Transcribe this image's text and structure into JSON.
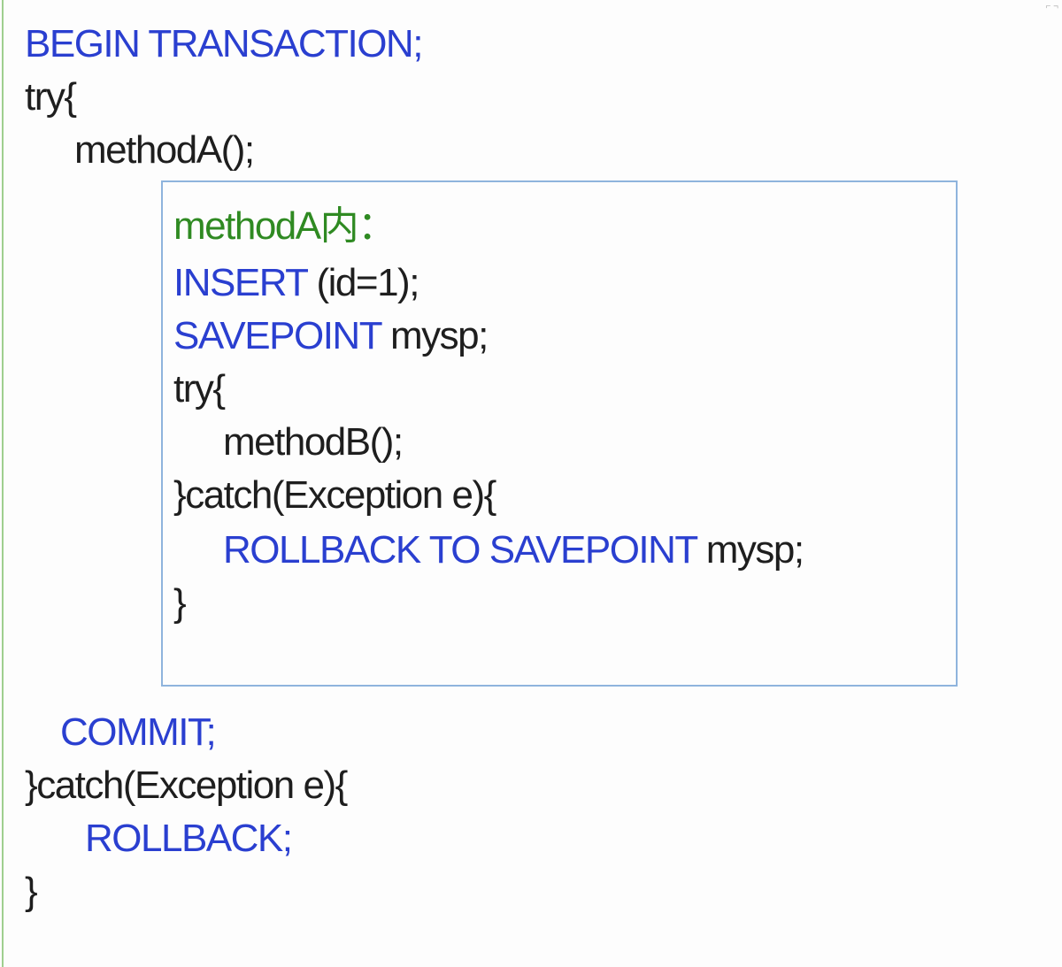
{
  "outer": {
    "begin": "BEGIN TRANSACTION;",
    "try_open": "try{",
    "call_a": "methodA();",
    "commit": "COMMIT;",
    "catch_open": "}catch(Exception e){",
    "rollback": "ROLLBACK;",
    "close": "}"
  },
  "inner": {
    "heading": "methodA内：",
    "insert_kw": "INSERT",
    "insert_rest": " (id=1);",
    "savepoint_kw": "SAVEPOINT",
    "savepoint_rest": " mysp;",
    "try_open": "try{",
    "call_b": "methodB();",
    "catch_open": "}catch(Exception e){",
    "rollback_kw": "ROLLBACK TO SAVEPOINT",
    "rollback_rest": " mysp;",
    "close": "}"
  },
  "colors": {
    "keyword": "#2a3fd0",
    "comment": "#2f8a22",
    "text": "#1e1e1e",
    "box_border": "#8fb4dd"
  }
}
